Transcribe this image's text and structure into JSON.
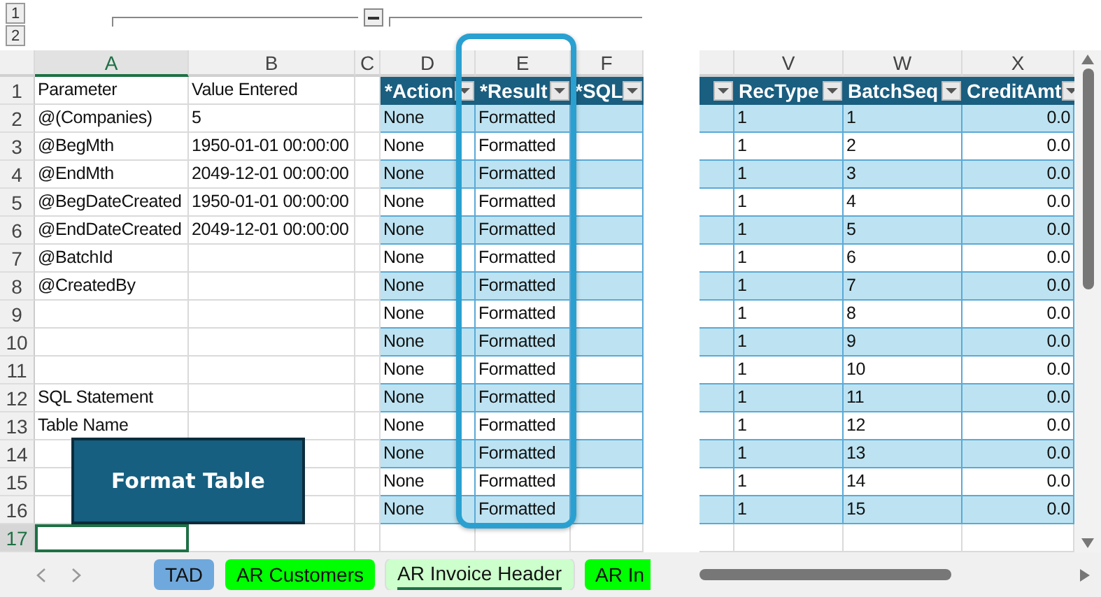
{
  "outline": {
    "levels": [
      "1",
      "2"
    ]
  },
  "left_columns": [
    {
      "label": "A",
      "selected": true
    },
    {
      "label": "B",
      "selected": false
    },
    {
      "label": "C",
      "selected": false
    },
    {
      "label": "D",
      "selected": false
    },
    {
      "label": "E",
      "selected": false
    },
    {
      "label": "F",
      "selected": false
    }
  ],
  "right_columns": [
    {
      "label": "V",
      "selected": false
    },
    {
      "label": "W",
      "selected": false
    },
    {
      "label": "X",
      "selected": false
    }
  ],
  "header_row": {
    "number": "1",
    "parameter": "Parameter",
    "value": "Value Entered",
    "left_table_headers": [
      "*Action",
      "*Result",
      "*SQL"
    ],
    "right_table_headers": [
      "RecType",
      "BatchSeq",
      "CreditAmt"
    ]
  },
  "rows": [
    {
      "number": "2",
      "parameter": "@(Companies)",
      "value": "5",
      "action": "None",
      "result": "Formatted",
      "rec_type": "1",
      "batch_seq": "1",
      "credit_amt": "0.0",
      "selected": false
    },
    {
      "number": "3",
      "parameter": "@BegMth",
      "value": "1950-01-01 00:00:00",
      "action": "None",
      "result": "Formatted",
      "rec_type": "1",
      "batch_seq": "2",
      "credit_amt": "0.0",
      "selected": false
    },
    {
      "number": "4",
      "parameter": "@EndMth",
      "value": "2049-12-01 00:00:00",
      "action": "None",
      "result": "Formatted",
      "rec_type": "1",
      "batch_seq": "3",
      "credit_amt": "0.0",
      "selected": false
    },
    {
      "number": "5",
      "parameter": "@BegDateCreated",
      "value": "1950-01-01 00:00:00",
      "action": "None",
      "result": "Formatted",
      "rec_type": "1",
      "batch_seq": "4",
      "credit_amt": "0.0",
      "selected": false
    },
    {
      "number": "6",
      "parameter": "@EndDateCreated",
      "value": "2049-12-01 00:00:00",
      "action": "None",
      "result": "Formatted",
      "rec_type": "1",
      "batch_seq": "5",
      "credit_amt": "0.0",
      "selected": false
    },
    {
      "number": "7",
      "parameter": "@BatchId",
      "action": "None",
      "result": "Formatted",
      "rec_type": "1",
      "batch_seq": "6",
      "credit_amt": "0.0",
      "selected": false
    },
    {
      "number": "8",
      "parameter": "@CreatedBy",
      "action": "None",
      "result": "Formatted",
      "rec_type": "1",
      "batch_seq": "7",
      "credit_amt": "0.0",
      "selected": false
    },
    {
      "number": "9",
      "action": "None",
      "result": "Formatted",
      "rec_type": "1",
      "batch_seq": "8",
      "credit_amt": "0.0",
      "selected": false
    },
    {
      "number": "10",
      "action": "None",
      "result": "Formatted",
      "rec_type": "1",
      "batch_seq": "9",
      "credit_amt": "0.0",
      "selected": false
    },
    {
      "number": "11",
      "action": "None",
      "result": "Formatted",
      "rec_type": "1",
      "batch_seq": "10",
      "credit_amt": "0.0",
      "selected": false
    },
    {
      "number": "12",
      "parameter": "SQL Statement",
      "action": "None",
      "result": "Formatted",
      "rec_type": "1",
      "batch_seq": "11",
      "credit_amt": "0.0",
      "selected": false
    },
    {
      "number": "13",
      "parameter": "Table Name",
      "action": "None",
      "result": "Formatted",
      "rec_type": "1",
      "batch_seq": "12",
      "credit_amt": "0.0",
      "selected": false
    },
    {
      "number": "14",
      "action": "None",
      "result": "Formatted",
      "rec_type": "1",
      "batch_seq": "13",
      "credit_amt": "0.0",
      "selected": false
    },
    {
      "number": "15",
      "action": "None",
      "result": "Formatted",
      "rec_type": "1",
      "batch_seq": "14",
      "credit_amt": "0.0",
      "selected": false
    },
    {
      "number": "16",
      "action": "None",
      "result": "Formatted",
      "rec_type": "1",
      "batch_seq": "15",
      "credit_amt": "0.0",
      "selected": false
    },
    {
      "number": "17",
      "selected": true
    }
  ],
  "format_button": "Format Table",
  "sheet_tabs": [
    {
      "label": "TAD",
      "color": "#6fa8dc",
      "selected": false
    },
    {
      "label": "AR Customers",
      "color": "#00ff00",
      "selected": false
    },
    {
      "label": "AR Invoice Header",
      "color": "#ccffcc",
      "selected": true
    },
    {
      "label": "AR In",
      "color": "#00ff00",
      "selected": false
    }
  ]
}
